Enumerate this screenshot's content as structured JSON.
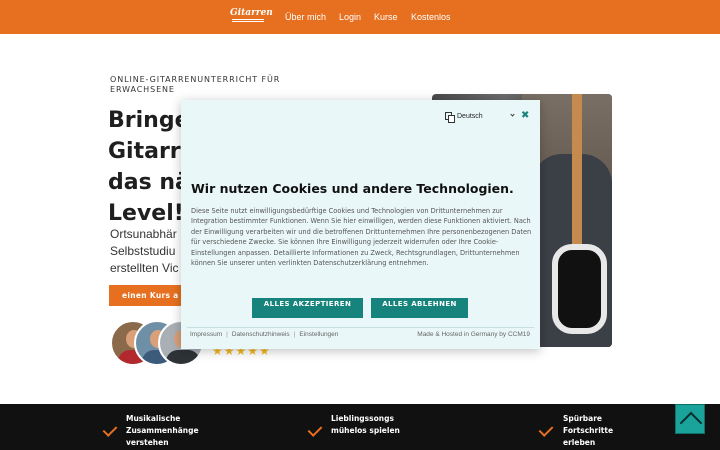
{
  "nav": {
    "logo_text": "Gitarren",
    "links": [
      "Über mich",
      "Login",
      "Kurse",
      "Kostenlos"
    ]
  },
  "hero": {
    "eyebrow": "ONLINE-GITARRENUNTERRICHT FÜR ERWACHSENE",
    "headline_lines": [
      "Bringe",
      "Gitarre",
      "das nä",
      "Level!"
    ],
    "subtext_lines": [
      "Ortsunabhär",
      "Selbststudiu",
      "erstellten Vic"
    ],
    "cta_label": "einen Kurs a",
    "stars": "★★★★★"
  },
  "cookie": {
    "language": "Deutsch",
    "title": "Wir nutzen Cookies und andere Technologien.",
    "body": "Diese Seite nutzt einwilligungsbedürftige Cookies und Technologien von Drittunternehmen zur Integration bestimmter Funktionen. Wenn Sie hier einwilligen, werden diese Funktionen aktiviert. Nach der Einwilligung verarbeiten wir und die betroffenen Drittunternehmen Ihre personenbezogenen Daten für verschiedene Zwecke. Sie können Ihre Einwilligung jederzeit widerrufen oder Ihre Cookie-Einstellungen anpassen. Detaillierte Informationen zu Zweck, Rechtsgrundlagen, Drittunternehmen können Sie unserer unten verlinkten Datenschutzerklärung entnehmen.",
    "accept_label": "ALLES AKZEPTIEREN",
    "reject_label": "ALLES ABLEHNEN",
    "footer_links": [
      "Impressum",
      "Datenschutzhinweis",
      "Einstellungen"
    ],
    "made_in": "Made & Hosted in Germany by CCM19"
  },
  "features": [
    {
      "label": "Musikalische Zusammenhänge verstehen"
    },
    {
      "label": "Lieblingssongs mühelos spielen"
    },
    {
      "label": "Spürbare Fortschritte erleben"
    }
  ],
  "colors": {
    "brand_orange": "#e6701f",
    "cookie_teal": "#16847c",
    "modal_bg": "#eaf7f8",
    "band_dark": "#111111",
    "star_yellow": "#f5b921"
  }
}
